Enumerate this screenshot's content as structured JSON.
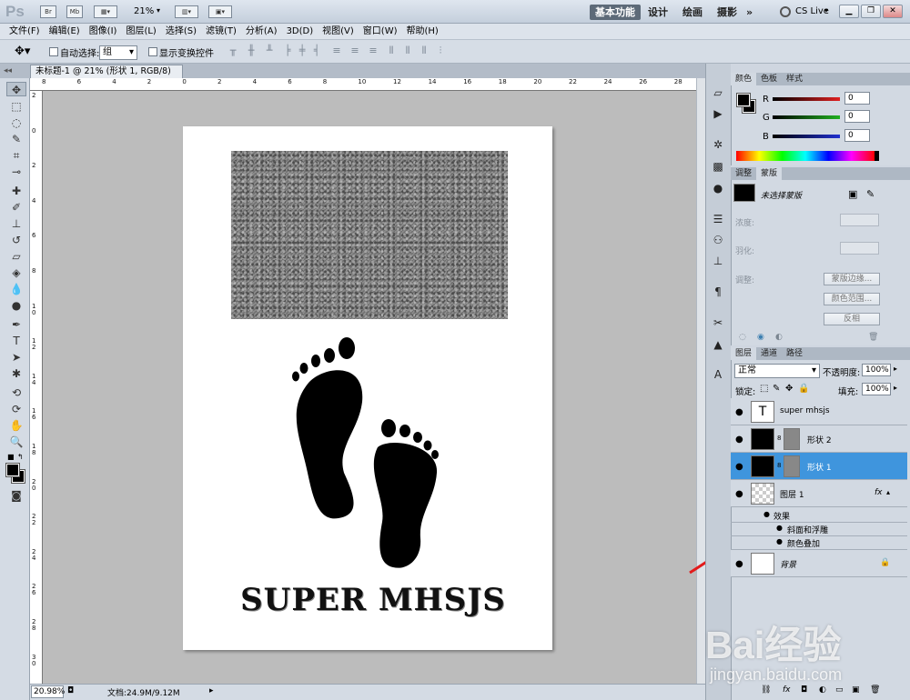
{
  "app": {
    "logo": "Ps",
    "zoom": "21%"
  },
  "workspaces": [
    "基本功能",
    "设计",
    "绘画",
    "摄影"
  ],
  "workspace_more": "»",
  "cs_live": "CS Live",
  "menu": [
    "文件(F)",
    "编辑(E)",
    "图像(I)",
    "图层(L)",
    "选择(S)",
    "滤镜(T)",
    "分析(A)",
    "3D(D)",
    "视图(V)",
    "窗口(W)",
    "帮助(H)"
  ],
  "options": {
    "auto_select_label": "自动选择:",
    "auto_select_value": "组",
    "show_transform_label": "显示变换控件"
  },
  "document_tab": {
    "title": "未标题-1 @ 21% (形状 1, RGB/8) *"
  },
  "hruler_labels": [
    "8",
    "6",
    "4",
    "2",
    "0",
    "2",
    "4",
    "6",
    "8",
    "10",
    "12",
    "14",
    "16",
    "18",
    "20",
    "22",
    "24",
    "26",
    "28"
  ],
  "vruler_labels": [
    "2",
    "0",
    "2",
    "4",
    "6",
    "8",
    "10",
    "12",
    "14",
    "16",
    "18",
    "20",
    "22",
    "24",
    "26",
    "28",
    "30"
  ],
  "canvas": {
    "headline": "SUPER MHSJS"
  },
  "status": {
    "zoom": "20.98%",
    "doc": "文档:24.9M/9.12M"
  },
  "color_panel": {
    "tabs": [
      "颜色",
      "色板",
      "样式"
    ],
    "channels": [
      {
        "label": "R",
        "value": "0",
        "color": "#e02020"
      },
      {
        "label": "G",
        "value": "0",
        "color": "#20b020"
      },
      {
        "label": "B",
        "value": "0",
        "color": "#2030d0"
      }
    ]
  },
  "adjust_panel": {
    "tabs": [
      "调整",
      "蒙版"
    ],
    "no_mask": "未选择蒙版",
    "density": "浓度:",
    "feather": "羽化:",
    "refine": "调整:",
    "btn_edge": "蒙版边缘...",
    "btn_range": "颜色范围...",
    "btn_invert": "反相"
  },
  "layers_panel": {
    "tabs": [
      "图层",
      "通道",
      "路径"
    ],
    "blend_mode": "正常",
    "opacity_label": "不透明度:",
    "opacity": "100%",
    "lock_label": "锁定:",
    "fill_label": "填充:",
    "fill": "100%",
    "layers": [
      {
        "name": "super mhsjs",
        "type": "text"
      },
      {
        "name": "形状 2",
        "type": "shape"
      },
      {
        "name": "形状 1",
        "type": "shape",
        "selected": true
      },
      {
        "name": "图层 1",
        "type": "pixel",
        "fx": "fx"
      },
      {
        "name": "背景",
        "type": "background"
      }
    ],
    "effects_label": "效果",
    "effects": [
      "斜面和浮雕",
      "颜色叠加"
    ]
  },
  "watermark": {
    "brand": "Bai经验",
    "url": "jingyan.baidu.com"
  }
}
